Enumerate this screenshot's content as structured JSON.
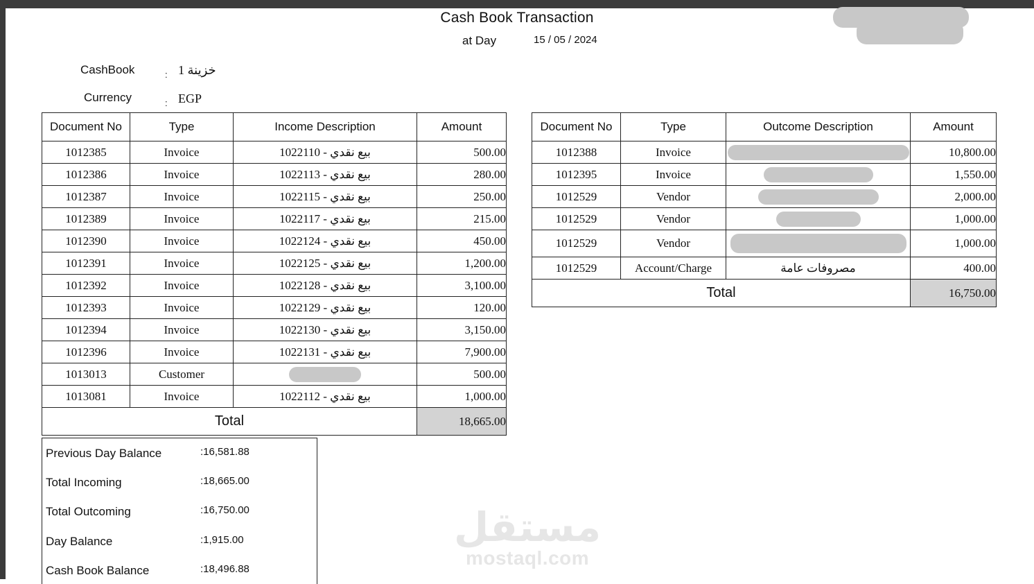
{
  "header": {
    "title": "Cash Book Transaction",
    "at_day_label": "at Day",
    "date": "15 / 05 / 2024",
    "cashbook_label": "CashBook",
    "cashbook_value": "خزينة 1",
    "currency_label": "Currency",
    "currency_value": "EGP",
    "colon": ":"
  },
  "income": {
    "columns": [
      "Document No",
      "Type",
      "Income Description",
      "Amount"
    ],
    "rows": [
      {
        "doc": "1012385",
        "type": "Invoice",
        "desc": "بيع نقدي - 1022110",
        "amount": "500.00"
      },
      {
        "doc": "1012386",
        "type": "Invoice",
        "desc": "بيع نقدي - 1022113",
        "amount": "280.00"
      },
      {
        "doc": "1012387",
        "type": "Invoice",
        "desc": "بيع نقدي - 1022115",
        "amount": "250.00"
      },
      {
        "doc": "1012389",
        "type": "Invoice",
        "desc": "بيع نقدي - 1022117",
        "amount": "215.00"
      },
      {
        "doc": "1012390",
        "type": "Invoice",
        "desc": "بيع نقدي - 1022124",
        "amount": "450.00"
      },
      {
        "doc": "1012391",
        "type": "Invoice",
        "desc": "بيع نقدي - 1022125",
        "amount": "1,200.00"
      },
      {
        "doc": "1012392",
        "type": "Invoice",
        "desc": "بيع نقدي - 1022128",
        "amount": "3,100.00"
      },
      {
        "doc": "1012393",
        "type": "Invoice",
        "desc": "بيع نقدي - 1022129",
        "amount": "120.00"
      },
      {
        "doc": "1012394",
        "type": "Invoice",
        "desc": "بيع نقدي - 1022130",
        "amount": "3,150.00"
      },
      {
        "doc": "1012396",
        "type": "Invoice",
        "desc": "بيع نقدي - 1022131",
        "amount": "7,900.00"
      },
      {
        "doc": "1013013",
        "type": "Customer",
        "desc": "",
        "amount": "500.00"
      },
      {
        "doc": "1013081",
        "type": "Invoice",
        "desc": "بيع نقدي - 1022112",
        "amount": "1,000.00"
      }
    ],
    "total_label": "Total",
    "total": "18,665.00"
  },
  "outcome": {
    "columns": [
      "Document No",
      "Type",
      "Outcome Description",
      "Amount"
    ],
    "rows": [
      {
        "doc": "1012388",
        "type": "Invoice",
        "desc": "",
        "amount": "10,800.00"
      },
      {
        "doc": "1012395",
        "type": "Invoice",
        "desc": "",
        "amount": "1,550.00"
      },
      {
        "doc": "1012529",
        "type": "Vendor",
        "desc": "",
        "amount": "2,000.00"
      },
      {
        "doc": "1012529",
        "type": "Vendor",
        "desc": "",
        "amount": "1,000.00"
      },
      {
        "doc": "1012529",
        "type": "Vendor",
        "desc": "",
        "amount": "1,000.00"
      },
      {
        "doc": "1012529",
        "type": "Account/Charge",
        "desc": "مصروفات عامة",
        "amount": "400.00"
      }
    ],
    "total_label": "Total",
    "total": "16,750.00"
  },
  "summary": {
    "rows": [
      {
        "label": "Previous Day Balance",
        "value": ":16,581.88"
      },
      {
        "label": "Total Incoming",
        "value": ":18,665.00"
      },
      {
        "label": "Total Outcoming",
        "value": ":16,750.00"
      },
      {
        "label": "Day Balance",
        "value": ":1,915.00"
      },
      {
        "label": "Cash Book Balance",
        "value": ":18,496.88"
      }
    ]
  },
  "watermark": {
    "arabic": "مستقل",
    "latin": "mostaql.com"
  }
}
